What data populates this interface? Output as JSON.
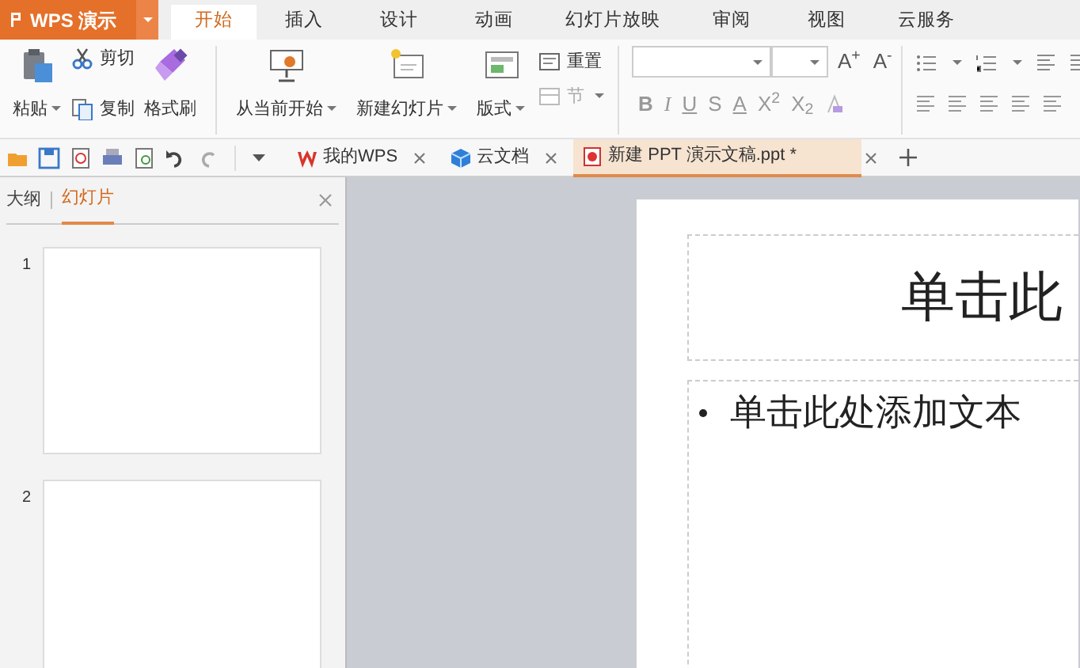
{
  "app_menu": {
    "label": "WPS 演示"
  },
  "ribbon_tabs": [
    {
      "label": "开始",
      "selected": true
    },
    {
      "label": "插入",
      "selected": false
    },
    {
      "label": "设计",
      "selected": false
    },
    {
      "label": "动画",
      "selected": false
    },
    {
      "label": "幻灯片放映",
      "selected": false
    },
    {
      "label": "审阅",
      "selected": false
    },
    {
      "label": "视图",
      "selected": false
    },
    {
      "label": "云服务",
      "selected": false
    }
  ],
  "clipboard": {
    "paste": "粘贴",
    "cut": "剪切",
    "copy": "复制",
    "format_painter": "格式刷"
  },
  "slides_group": {
    "from_current": "从当前开始",
    "new_slide": "新建幻灯片",
    "layout": "版式",
    "reset": {
      "label": "重置",
      "disabled": false
    },
    "section": {
      "label": "节",
      "disabled": true
    }
  },
  "font_size_buttons": [
    "A$^{+}$",
    "A$^{-}$"
  ],
  "format_buttons": [
    "B",
    "I",
    "U",
    "S",
    "A",
    "X$^{2}$",
    "X$_{2}$"
  ],
  "doc_tabs": [
    {
      "label": "我的WPS",
      "selected": false,
      "kind": "wps"
    },
    {
      "label": "云文档",
      "selected": false,
      "kind": "cloud"
    },
    {
      "label": "新建 PPT 演示文稿.ppt *",
      "selected": true,
      "kind": "ppt"
    }
  ],
  "side_panel": {
    "tabs": [
      {
        "label": "大纲",
        "selected": false
      },
      {
        "label": "幻灯片",
        "selected": true
      }
    ],
    "slides": [
      {
        "number": "1"
      },
      {
        "number": "2"
      }
    ]
  },
  "slide": {
    "title": "单击此",
    "body": "单击此处添加文本"
  }
}
